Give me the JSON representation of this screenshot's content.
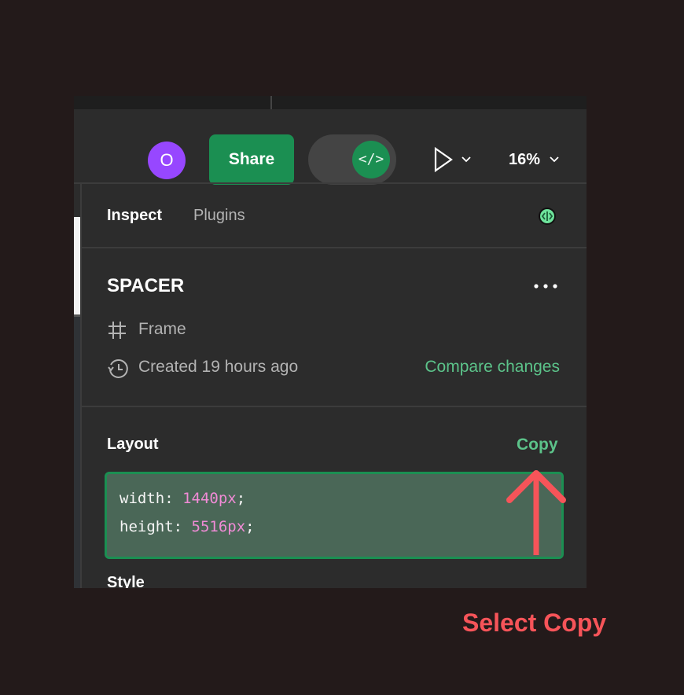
{
  "toolbar": {
    "avatar_initial": "O",
    "share_label": "Share",
    "dev_mode_icon": "code-brackets-icon",
    "dev_mode_symbol": "</>",
    "play_icon": "play-icon",
    "zoom_level": "16%"
  },
  "tabs": [
    {
      "label": "Inspect",
      "active": true
    },
    {
      "label": "Plugins",
      "active": false
    }
  ],
  "status_icon": "dev-status-icon",
  "node": {
    "name": "SPACER",
    "type": "Frame",
    "created": "Created 19 hours ago",
    "compare_label": "Compare changes"
  },
  "layout": {
    "title": "Layout",
    "copy_label": "Copy",
    "code": [
      {
        "prop": "width",
        "value": "1440px"
      },
      {
        "prop": "height",
        "value": "5516px"
      }
    ]
  },
  "next_section_partial": "Style",
  "annotation": {
    "label": "Select Copy",
    "color": "#f65459"
  },
  "colors": {
    "accent_green": "#1b8f52",
    "link_green": "#5cc38a",
    "avatar_purple": "#9747ff",
    "code_value_pink": "#f08bd6",
    "panel_bg": "#2c2c2c"
  }
}
